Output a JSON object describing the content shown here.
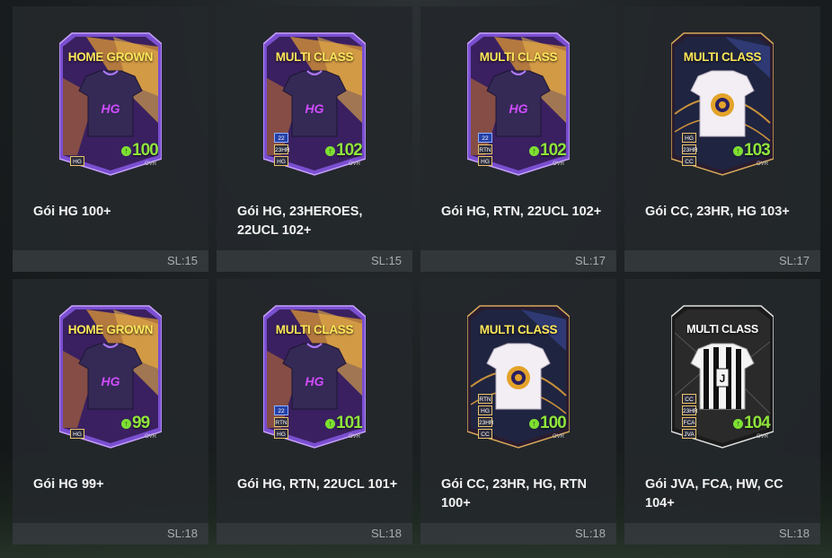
{
  "colors": {
    "accent_rating": "#8fe43c",
    "label_yellow": "#ffe85a",
    "tile_bg": "#24282b"
  },
  "packs": [
    {
      "title": "Gói HG 100+",
      "qty": "SL:15",
      "card": {
        "label": "HOME GROWN",
        "style": "hg",
        "shirt": "purple-jersey",
        "badges": [
          "HG"
        ],
        "rating": "100",
        "ovr": "OVR"
      }
    },
    {
      "title": "Gói HG, 23HEROES, 22UCL 102+",
      "qty": "SL:15",
      "card": {
        "label": "MULTI CLASS",
        "style": "hg",
        "shirt": "purple-jersey",
        "badges": [
          "22",
          "23HR",
          "HG"
        ],
        "rating": "102",
        "ovr": "OVR"
      }
    },
    {
      "title": "Gói HG, RTN, 22UCL 102+",
      "qty": "SL:17",
      "card": {
        "label": "MULTI CLASS",
        "style": "hg",
        "shirt": "purple-jersey",
        "badges": [
          "22",
          "RTN",
          "HG"
        ],
        "rating": "102",
        "ovr": "OVR"
      }
    },
    {
      "title": "Gói CC, 23HR, HG 103+",
      "qty": "SL:17",
      "card": {
        "label": "MULTI CLASS",
        "style": "cc",
        "shirt": "white-jersey",
        "badges": [
          "HG",
          "23HR",
          "CC"
        ],
        "rating": "103",
        "ovr": "OVR"
      }
    },
    {
      "title": "Gói HG 99+",
      "qty": "SL:18",
      "card": {
        "label": "HOME GROWN",
        "style": "hg",
        "shirt": "purple-jersey",
        "badges": [
          "HG"
        ],
        "rating": "99",
        "ovr": "OVR"
      }
    },
    {
      "title": "Gói HG, RTN, 22UCL 101+",
      "qty": "SL:18",
      "card": {
        "label": "MULTI CLASS",
        "style": "hg",
        "shirt": "purple-jersey",
        "badges": [
          "22",
          "RTN",
          "HG"
        ],
        "rating": "101",
        "ovr": "OVR"
      }
    },
    {
      "title": "Gói CC, 23HR, HG, RTN 100+",
      "qty": "SL:18",
      "card": {
        "label": "MULTI CLASS",
        "style": "cc",
        "shirt": "white-jersey",
        "badges": [
          "RTN",
          "HG",
          "23HR",
          "CC"
        ],
        "rating": "100",
        "ovr": "OVR"
      }
    },
    {
      "title": "Gói JVA, FCA, HW, CC 104+",
      "qty": "SL:18",
      "card": {
        "label": "MULTI CLASS",
        "style": "juve",
        "shirt": "juventus-jersey",
        "badges": [
          "CC",
          "23HR",
          "FCA",
          "JVA"
        ],
        "rating": "104",
        "ovr": "OVR"
      }
    }
  ]
}
